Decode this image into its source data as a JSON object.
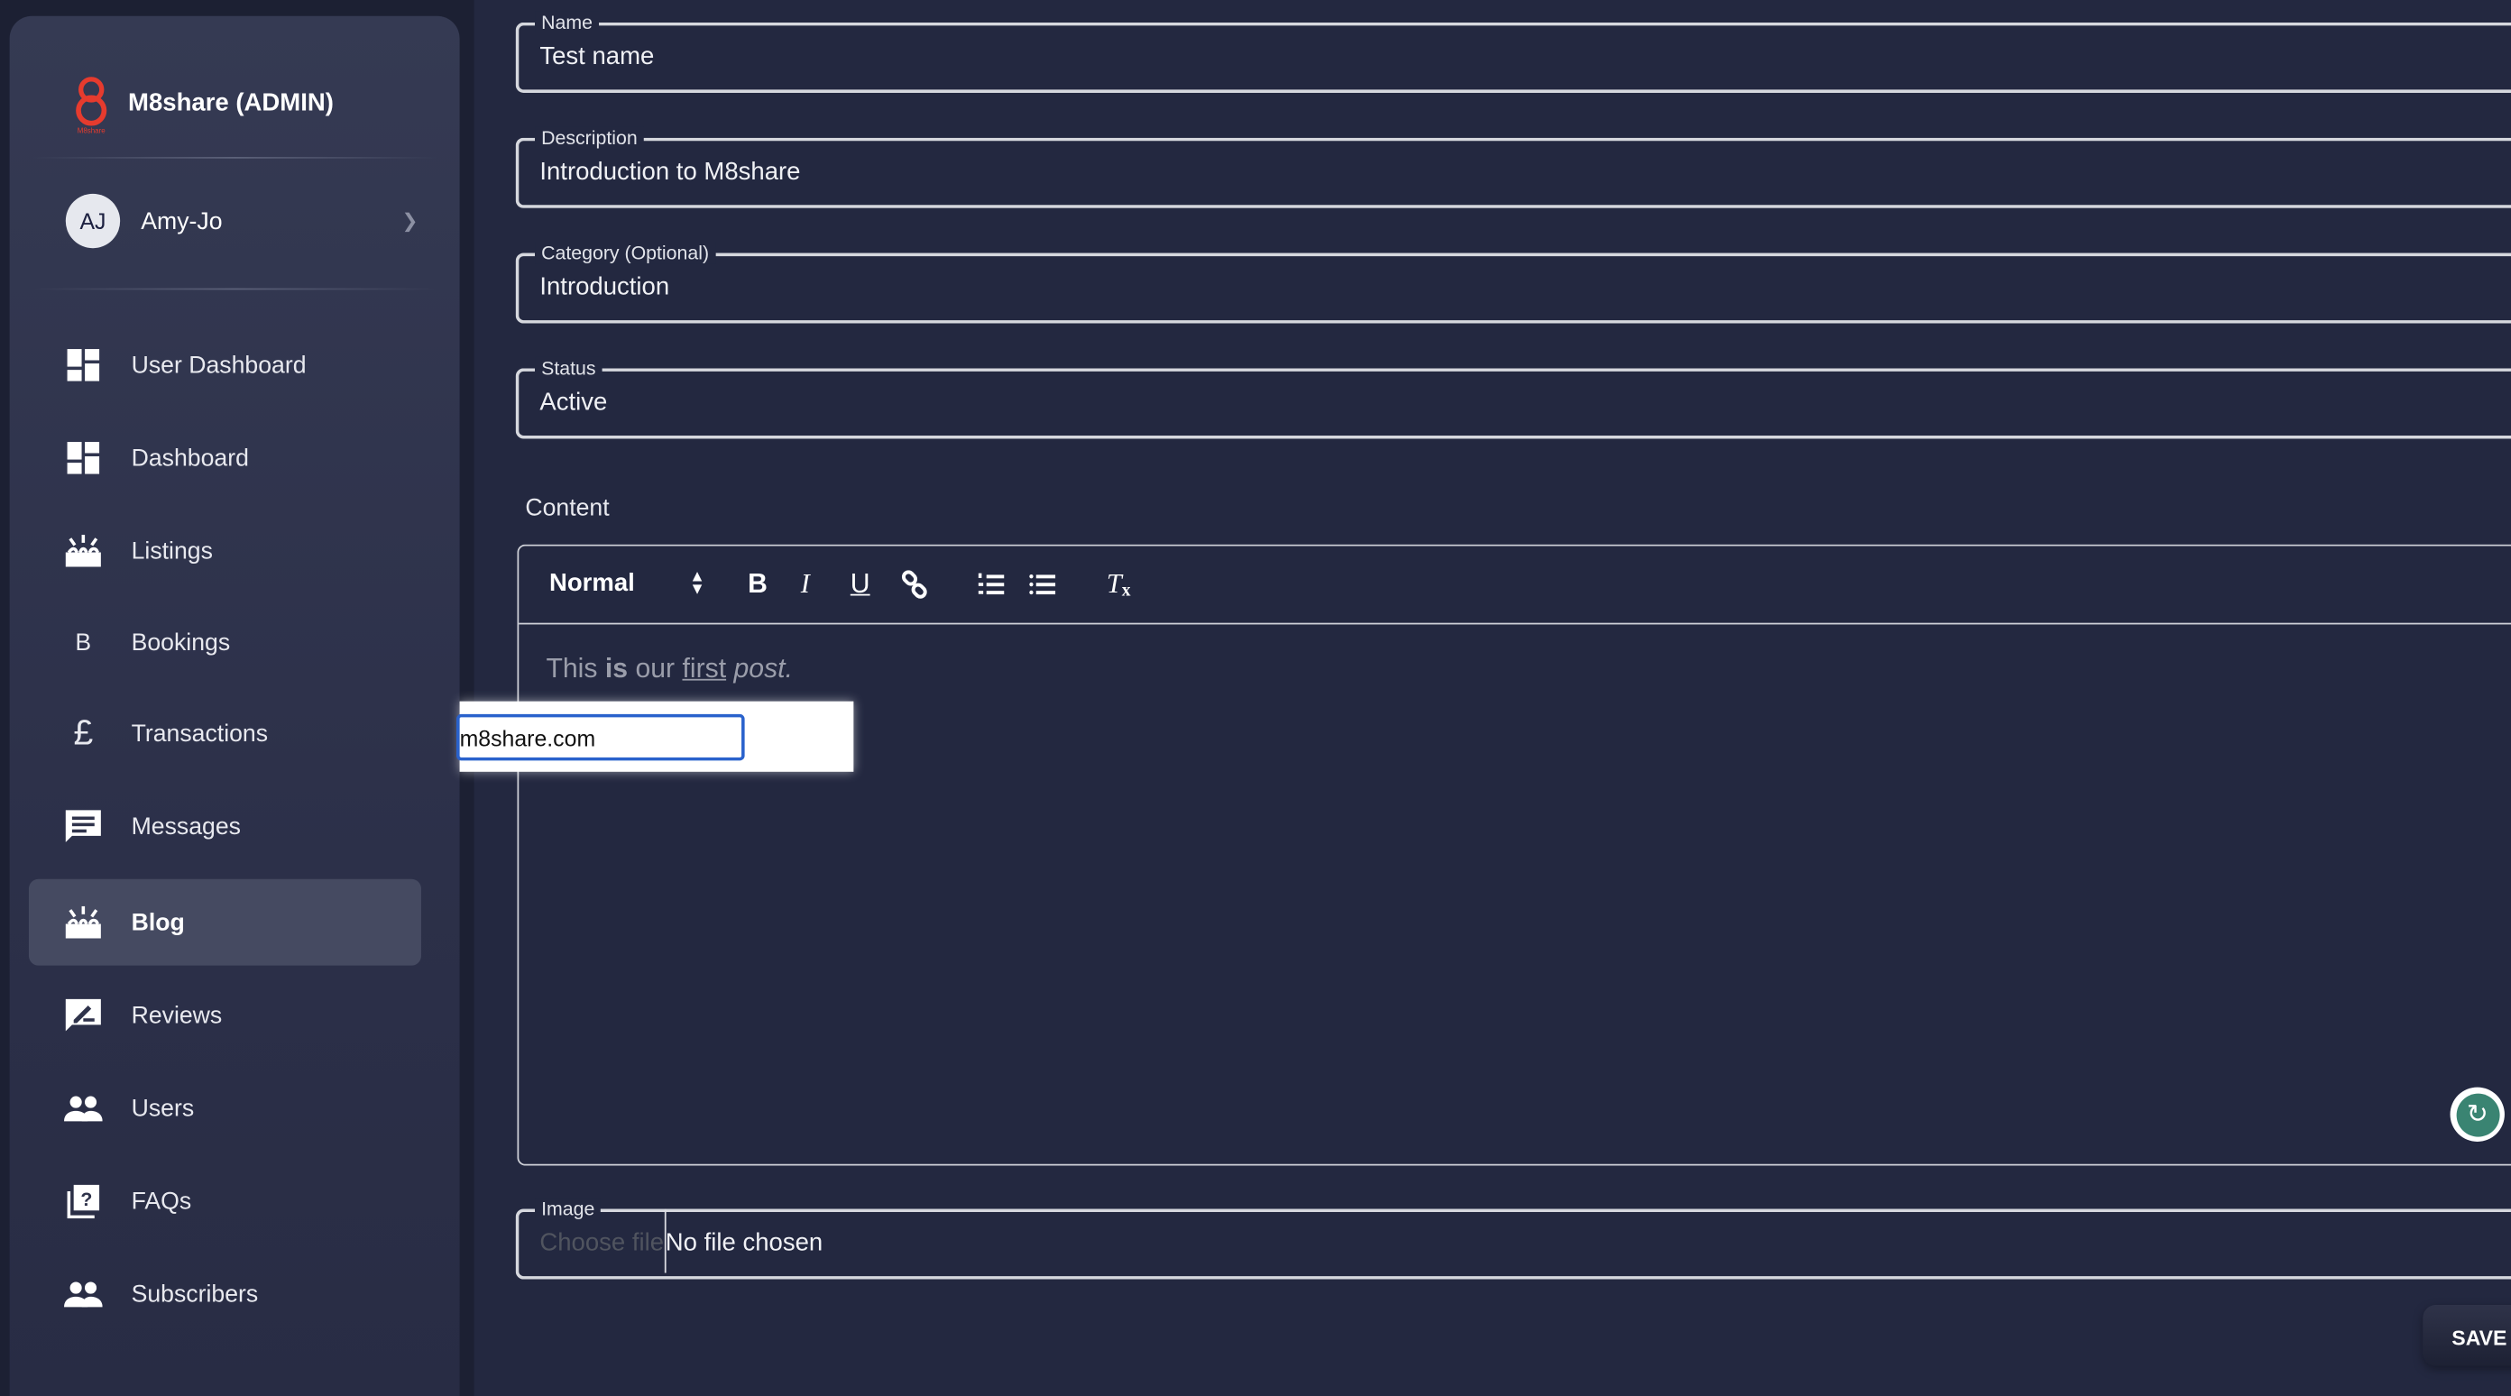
{
  "brand": {
    "title": "M8share (ADMIN)",
    "logo_text": "M8share",
    "color": "#e63b2e"
  },
  "user": {
    "initials": "AJ",
    "name": "Amy-Jo"
  },
  "nav": [
    {
      "label": "User Dashboard",
      "icon": "dashboard-icon"
    },
    {
      "label": "Dashboard",
      "icon": "dashboard-icon"
    },
    {
      "label": "Listings",
      "icon": "celebration-icon"
    },
    {
      "label": "Bookings",
      "icon": "letter-b-icon",
      "glyph": "B"
    },
    {
      "label": "Transactions",
      "icon": "pound-icon",
      "glyph": "£"
    },
    {
      "label": "Messages",
      "icon": "message-icon"
    },
    {
      "label": "Blog",
      "icon": "celebration-icon",
      "active": true
    },
    {
      "label": "Reviews",
      "icon": "rate-review-icon"
    },
    {
      "label": "Users",
      "icon": "people-icon"
    },
    {
      "label": "FAQs",
      "icon": "quiz-icon"
    },
    {
      "label": "Subscribers",
      "icon": "people-icon"
    }
  ],
  "form": {
    "name": {
      "label": "Name",
      "value": "Test name"
    },
    "description": {
      "label": "Description",
      "value": "Introduction to M8share"
    },
    "category": {
      "label": "Category (Optional)",
      "value": "Introduction"
    },
    "status": {
      "label": "Status",
      "value": "Active"
    },
    "content_label": "Content",
    "toolbar": {
      "format": "Normal"
    },
    "content": {
      "t1": "This ",
      "t2": "is",
      "t3": " our ",
      "t4": "first",
      "t5": " ",
      "t6": "post."
    },
    "link_popup_value": "m8share.com",
    "image": {
      "label": "Image",
      "button": "Choose file",
      "status": "No file chosen"
    },
    "save": "SAVE"
  }
}
